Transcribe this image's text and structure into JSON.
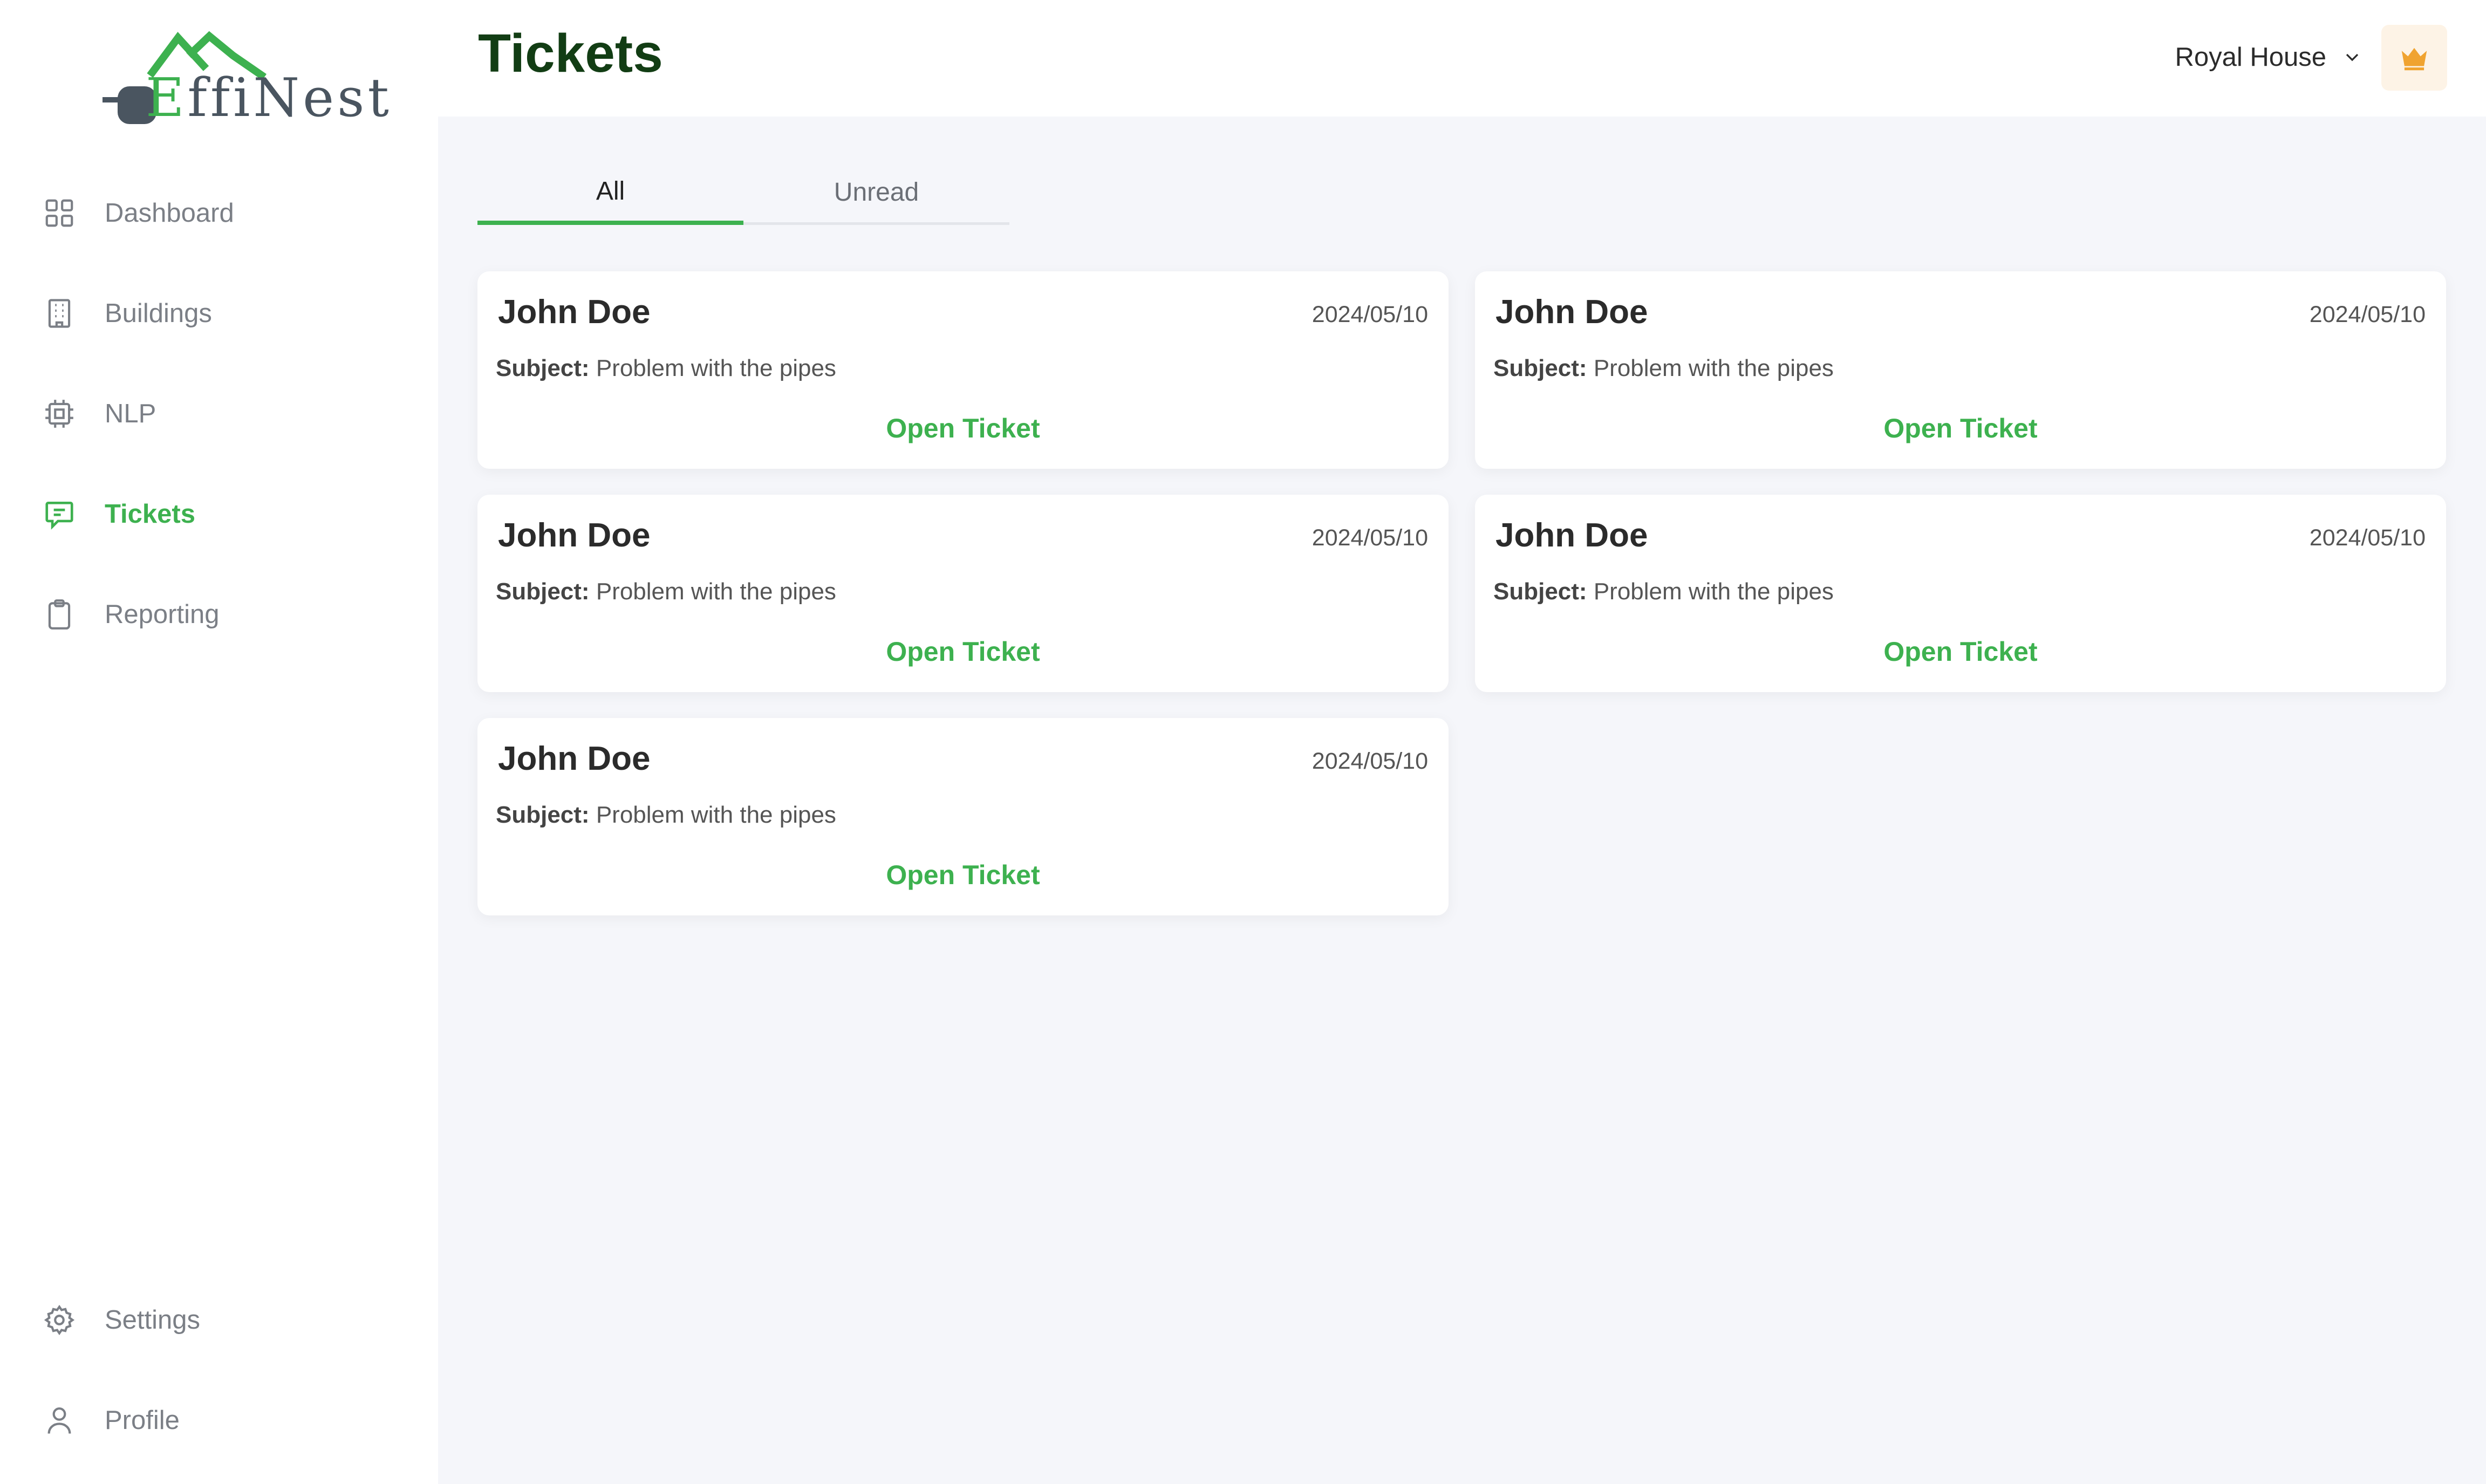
{
  "app": {
    "logo_alt": "EffiNest",
    "logo_e": "E",
    "logo_rest": "ffiNest"
  },
  "sidebar": {
    "items": [
      {
        "label": "Dashboard",
        "icon": "grid-icon"
      },
      {
        "label": "Buildings",
        "icon": "building-icon"
      },
      {
        "label": "NLP",
        "icon": "chip-icon"
      },
      {
        "label": "Tickets",
        "icon": "message-icon",
        "active": true
      },
      {
        "label": "Reporting",
        "icon": "clipboard-icon"
      }
    ],
    "bottom_items": [
      {
        "label": "Settings",
        "icon": "gear-icon"
      },
      {
        "label": "Profile",
        "icon": "user-icon"
      }
    ]
  },
  "header": {
    "title": "Tickets",
    "org_selector": "Royal House",
    "premium_icon": "crown-icon"
  },
  "tabs": [
    {
      "label": "All",
      "active": true
    },
    {
      "label": "Unread",
      "active": false
    }
  ],
  "tickets": [
    {
      "name": "John Doe",
      "date": "2024/05/10",
      "subject_label": "Subject:",
      "subject": "Problem with the pipes",
      "action": "Open Ticket"
    },
    {
      "name": "John Doe",
      "date": "2024/05/10",
      "subject_label": "Subject:",
      "subject": "Problem with the pipes",
      "action": "Open Ticket"
    },
    {
      "name": "John Doe",
      "date": "2024/05/10",
      "subject_label": "Subject:",
      "subject": "Problem with the pipes",
      "action": "Open Ticket"
    },
    {
      "name": "John Doe",
      "date": "2024/05/10",
      "subject_label": "Subject:",
      "subject": "Problem with the pipes",
      "action": "Open Ticket"
    },
    {
      "name": "John Doe",
      "date": "2024/05/10",
      "subject_label": "Subject:",
      "subject": "Problem with the pipes",
      "action": "Open Ticket"
    }
  ],
  "colors": {
    "accent": "#3db14f",
    "title": "#123d14",
    "muted": "#7b7f86",
    "background": "#f5f6fa",
    "crown": "#f0a330"
  }
}
